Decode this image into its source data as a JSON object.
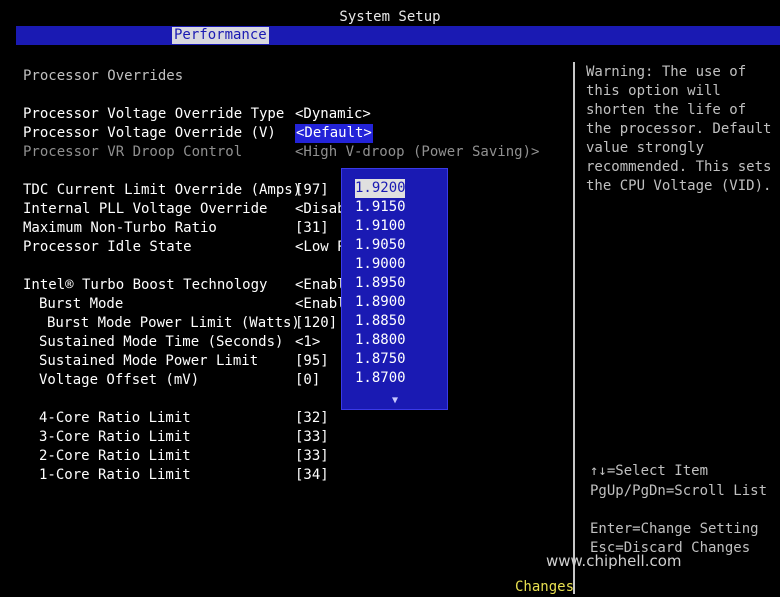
{
  "header": {
    "title": "System Setup",
    "active_tab": "Performance"
  },
  "section_title": "Processor Overrides",
  "settings": [
    {
      "label": "Processor Voltage Override Type",
      "value": "<Dynamic>"
    },
    {
      "label": "Processor Voltage Override (V)",
      "value": "<Default>"
    },
    {
      "label": "Processor VR Droop Control",
      "value": "<High V-droop (Power Saving)>"
    },
    {
      "label": "TDC Current Limit Override (Amps)",
      "value": "[97]"
    },
    {
      "label": "Internal PLL Voltage Override",
      "value": "<Disab"
    },
    {
      "label": "Maximum Non-Turbo Ratio",
      "value": "[31]"
    },
    {
      "label": "Processor Idle State",
      "value": "<Low P"
    },
    {
      "label": "Intel® Turbo Boost Technology",
      "value": "<Enabl"
    },
    {
      "label": "Burst Mode",
      "value": "<Enabl"
    },
    {
      "label": "Burst Mode Power Limit (Watts)",
      "value": "[120]"
    },
    {
      "label": "Sustained Mode Time (Seconds)",
      "value": "<1>"
    },
    {
      "label": "Sustained Mode Power Limit",
      "value": "[95]"
    },
    {
      "label": "Voltage Offset (mV)",
      "value": "[0]"
    },
    {
      "label": "4-Core Ratio Limit",
      "value": "[32]"
    },
    {
      "label": "3-Core Ratio Limit",
      "value": "[33]"
    },
    {
      "label": "2-Core Ratio Limit",
      "value": "[33]"
    },
    {
      "label": "1-Core Ratio Limit",
      "value": "[34]"
    }
  ],
  "popup_options": [
    "1.9200",
    "1.9150",
    "1.9100",
    "1.9050",
    "1.9000",
    "1.8950",
    "1.8900",
    "1.8850",
    "1.8800",
    "1.8750",
    "1.8700"
  ],
  "popup_scroll_icon": "down-arrow-icon",
  "help_lines": [
    "Warning: The use of",
    "this option will",
    "shorten the life of",
    "the processor. Default",
    "value strongly",
    "recommended. This sets",
    "the CPU Voltage (VID)."
  ],
  "key_help": {
    "select_item": "↑↓=Select Item",
    "scroll": "PgUp/PgDn=Scroll List",
    "change": "Enter=Change Setting",
    "discard": "Esc=Discard Changes"
  },
  "footer_text": "Changes",
  "watermark_text": "www.chiphell.com",
  "colors": {
    "tab_bar": "#1a1ab3",
    "highlight": "#2323d8",
    "footer": "#e8e050"
  }
}
